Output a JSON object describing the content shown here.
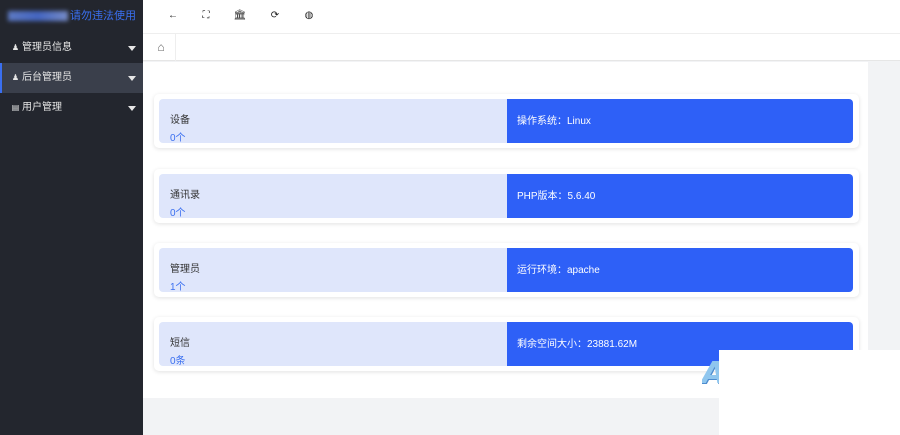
{
  "logo": {
    "text": "请勿违法使用"
  },
  "sidebar": {
    "items": [
      {
        "label": "管理员信息",
        "icon": "user-icon"
      },
      {
        "label": "后台管理员",
        "icon": "user-icon"
      },
      {
        "label": "用户管理",
        "icon": "id-card-icon"
      }
    ]
  },
  "toolbar": {
    "back_glyph": "←",
    "fullscreen_glyph": "⛶",
    "bank_glyph": "🏛",
    "refresh_glyph": "⟳",
    "theme_glyph": "◍"
  },
  "tabs": {
    "home_glyph": "⌂"
  },
  "cards": [
    {
      "name": "设备",
      "value": "0个",
      "info": "操作系统：Linux"
    },
    {
      "name": "通讯录",
      "value": "0个",
      "info": "PHP版本：5.6.40"
    },
    {
      "name": "管理员",
      "value": "1个",
      "info": "运行环境：apache"
    },
    {
      "name": "短信",
      "value": "0条",
      "info": "剩余空间大小：23881.62M"
    }
  ],
  "colors": {
    "sidebar_bg": "#23262e",
    "accent": "#2e60f7",
    "card_left_bg": "#dfe6fb"
  }
}
